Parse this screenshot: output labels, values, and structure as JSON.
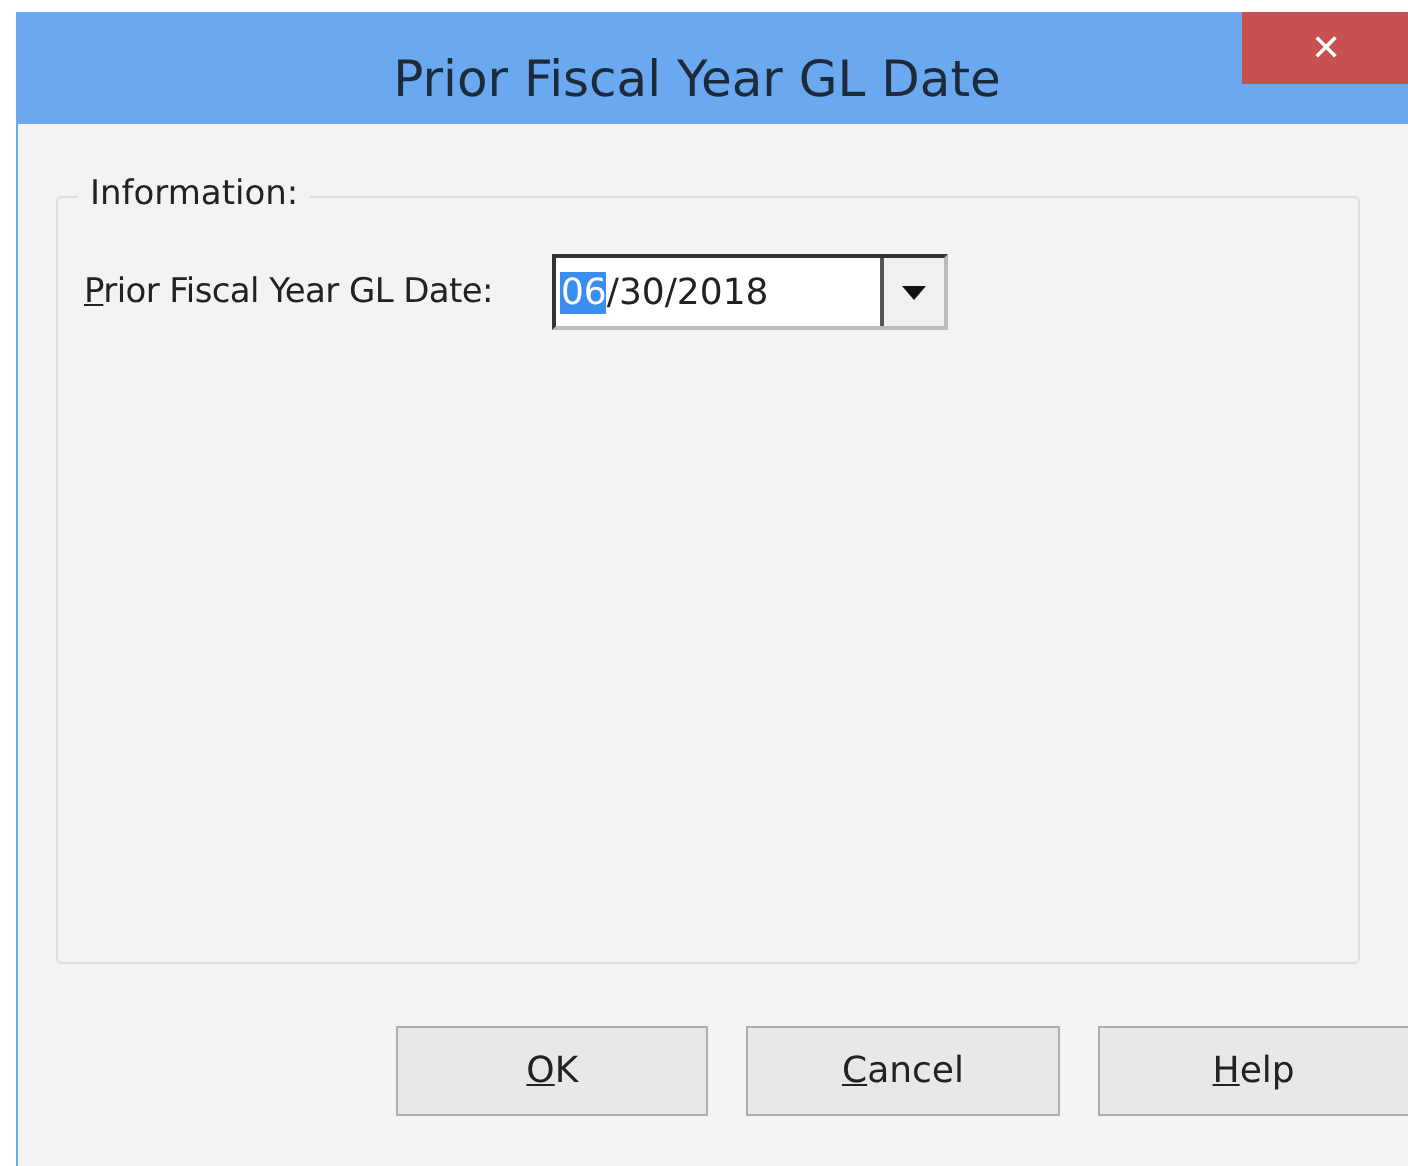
{
  "window": {
    "title": "Prior Fiscal Year GL Date",
    "close_glyph": "✕"
  },
  "group": {
    "title": "Information:",
    "field": {
      "label": [
        {
          "text": "P",
          "underlined": true
        },
        {
          "text": "rior Fiscal Year GL Date:",
          "underlined": false
        }
      ],
      "value": [
        {
          "text": "06",
          "selected": true
        },
        {
          "text": "/30/2018",
          "selected": false
        }
      ]
    }
  },
  "buttons": [
    {
      "label": [
        {
          "text": "O",
          "underlined": true
        },
        {
          "text": "K",
          "underlined": false
        }
      ]
    },
    {
      "label": [
        {
          "text": "C",
          "underlined": true
        },
        {
          "text": "ancel",
          "underlined": false
        }
      ]
    },
    {
      "label": [
        {
          "text": "H",
          "underlined": true
        },
        {
          "text": "elp",
          "underlined": false
        }
      ]
    }
  ]
}
